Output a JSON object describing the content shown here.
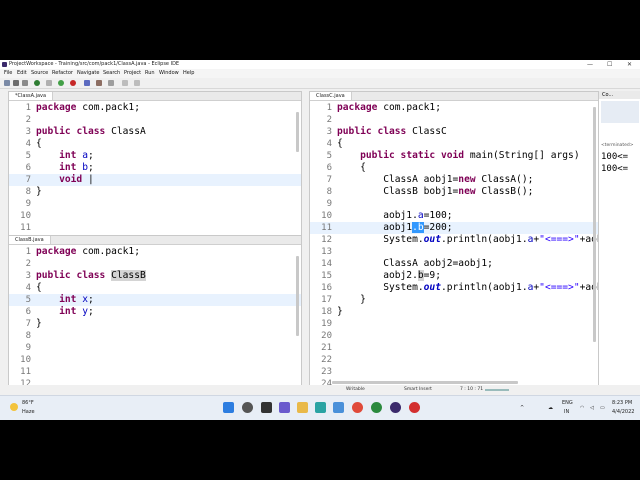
{
  "window": {
    "title": "ProjectWorkspace - Training/src/com/pack1/ClassA.java - Eclipse IDE"
  },
  "menu": [
    "File",
    "Edit",
    "Source",
    "Refactor",
    "Navigate",
    "Search",
    "Project",
    "Run",
    "Window",
    "Help"
  ],
  "editors": {
    "classA": {
      "tab": "*ClassA.java",
      "lines": [
        {
          "n": "1",
          "html": "<span class='kw'>package</span> com.pack1;"
        },
        {
          "n": "2",
          "html": ""
        },
        {
          "n": "3",
          "html": "<span class='kw'>public</span> <span class='kw'>class</span> ClassA"
        },
        {
          "n": "4",
          "html": "{"
        },
        {
          "n": "5",
          "html": "    <span class='kw'>int</span> <span class='fd'>a</span>;"
        },
        {
          "n": "6",
          "html": "    <span class='kw'>int</span> <span class='fd'>b</span>;"
        },
        {
          "n": "7",
          "html": "    <span class='kw'>void</span> |",
          "hl": true
        },
        {
          "n": "8",
          "html": "}"
        },
        {
          "n": "9",
          "html": ""
        },
        {
          "n": "10",
          "html": ""
        },
        {
          "n": "11",
          "html": ""
        }
      ]
    },
    "classB": {
      "tab": "ClassB.java",
      "lines": [
        {
          "n": "1",
          "html": "<span class='kw'>package</span> com.pack1;"
        },
        {
          "n": "2",
          "html": ""
        },
        {
          "n": "3",
          "html": "<span class='kw'>public</span> <span class='kw'>class</span> <span class='occ'>ClassB</span>"
        },
        {
          "n": "4",
          "html": "{"
        },
        {
          "n": "5",
          "html": "    <span class='kw'>int</span> <span class='fd'>x</span>;",
          "hl": true
        },
        {
          "n": "6",
          "html": "    <span class='kw'>int</span> <span class='fd'>y</span>;"
        },
        {
          "n": "7",
          "html": "}"
        },
        {
          "n": "8",
          "html": ""
        },
        {
          "n": "9",
          "html": ""
        },
        {
          "n": "10",
          "html": ""
        },
        {
          "n": "11",
          "html": ""
        },
        {
          "n": "12",
          "html": ""
        }
      ]
    },
    "classC": {
      "tab": "ClassC.java",
      "lines": [
        {
          "n": "1",
          "html": "<span class='kw'>package</span> com.pack1;"
        },
        {
          "n": "2",
          "html": ""
        },
        {
          "n": "3",
          "html": "<span class='kw'>public</span> <span class='kw'>class</span> ClassC"
        },
        {
          "n": "4",
          "html": "{"
        },
        {
          "n": "5",
          "html": "    <span class='kw'>public</span> <span class='kw'>static</span> <span class='kw'>void</span> main(String[] args)"
        },
        {
          "n": "6",
          "html": "    {"
        },
        {
          "n": "7",
          "html": "        ClassA aobj1=<span class='kw'>new</span> ClassA();"
        },
        {
          "n": "8",
          "html": "        ClassB bobj1=<span class='kw'>new</span> ClassB();"
        },
        {
          "n": "9",
          "html": ""
        },
        {
          "n": "10",
          "html": "        aobj1.<span class='fd'>a</span>=100;"
        },
        {
          "n": "11",
          "html": "        aobj1<span class='sel'>.b</span>=200;",
          "hl": true
        },
        {
          "n": "12",
          "html": "        System.<span class='it'>out</span>.println(aobj1.<span class='fd'>a</span>+<span class='st'>\"&lt;===&gt;\"</span>+aobj1."
        },
        {
          "n": "13",
          "html": ""
        },
        {
          "n": "14",
          "html": "        ClassA aobj2=aobj1;"
        },
        {
          "n": "15",
          "html": "        aobj2.<span class='occ'>b</span>=9;"
        },
        {
          "n": "16",
          "html": "        System.<span class='it'>out</span>.println(aobj1.<span class='fd'>a</span>+<span class='st'>\"&lt;===&gt;\"</span>+aobj1."
        },
        {
          "n": "17",
          "html": "    }"
        },
        {
          "n": "18",
          "html": "}"
        },
        {
          "n": "19",
          "html": ""
        },
        {
          "n": "20",
          "html": ""
        },
        {
          "n": "21",
          "html": ""
        },
        {
          "n": "22",
          "html": ""
        },
        {
          "n": "23",
          "html": ""
        },
        {
          "n": "24",
          "html": ""
        }
      ]
    }
  },
  "console": {
    "tab": "Co...",
    "status": "<terminated>",
    "lines": [
      "100<=",
      "100<="
    ]
  },
  "status": {
    "mode": "Writable",
    "insert": "Smart Insert",
    "pos": "7 : 10 : 71"
  },
  "taskbar": {
    "temp": "86°F",
    "weather": "Haze",
    "lang1": "ENG",
    "lang2": "IN",
    "time": "8:23 PM",
    "date": "4/4/2022"
  }
}
